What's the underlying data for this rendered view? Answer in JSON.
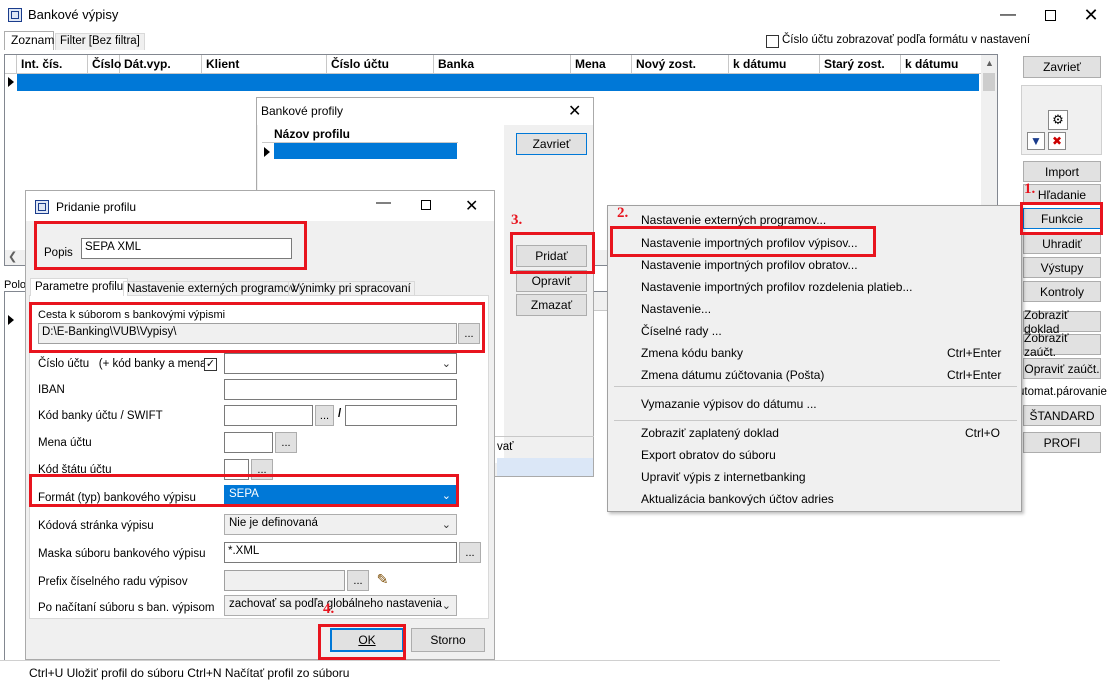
{
  "main_window": {
    "title": "Bankové výpisy",
    "tabs": [
      "Zoznam",
      "Filter [Bez filtra]"
    ],
    "checkbox_label": "Číslo účtu zobrazovať podľa formátu v nastavení",
    "columns": [
      "Int. čís.",
      "Číslo",
      "Dát.vyp.",
      "Klient",
      "Číslo účtu",
      "Banka",
      "Mena",
      "Nový zost.",
      "k dátumu",
      "Starý zost.",
      "k dátumu"
    ],
    "lower_tab_label": "Polo",
    "status_bar": "Ctrl+U Uložiť profil do súboru  Ctrl+N Načítať profil zo súboru"
  },
  "right_panel": {
    "buttons": {
      "zavriet": "Zavrieť",
      "import": "Import",
      "hladanie": "Hľadanie",
      "funkcie": "Funkcie",
      "uhradit": "Uhradiť",
      "vystupy": "Výstupy",
      "kontroly": "Kontroly",
      "zobrazit_doklad": "Zobraziť doklad",
      "zobrazit_zauct": "Zobraziť zaúčt.",
      "opravit_zauct": "Opraviť zaúčt.",
      "standard": "ŠTANDARD",
      "profi": "PROFI"
    },
    "automat_label": "utomat.párovanie"
  },
  "profiles_window": {
    "title": "Bankové profily",
    "column": "Názov profilu",
    "buttons": {
      "zavriet": "Zavrieť",
      "pridat": "Pridať",
      "opravit": "Opraviť",
      "zmazat": "Zmazať"
    },
    "partial_label": "vať"
  },
  "add_profile_dialog": {
    "title": "Pridanie profilu",
    "popis_label": "Popis",
    "popis_value": "SEPA XML",
    "tabs": [
      "Parametre profilu",
      "Nastavenie externých programov",
      "Výnimky pri spracovaní"
    ],
    "path_label": "Cesta k súborom s bankovými výpismi",
    "path_value": "D:\\E-Banking\\VUB\\Vypisy\\",
    "cislo_uctu_label": "Číslo účtu",
    "cislo_uctu_hint": "(+ kód banky a mena)",
    "iban_label": "IBAN",
    "swift_label": "Kód banky účtu / SWIFT",
    "mena_label": "Mena účtu",
    "stat_label": "Kód štátu účtu",
    "format_label": "Formát (typ) bankového výpisu",
    "format_value": "SEPA",
    "kodova_label": "Kódová stránka výpisu",
    "kodova_value": "Nie je definovaná",
    "maska_label": "Maska súboru bankového výpisu",
    "maska_value": "*.XML",
    "prefix_label": "Prefix číselného radu výpisov",
    "po_nacitani_label": "Po načítaní súboru s ban. výpisom",
    "po_nacitani_value": "zachovať sa podľa globálneho nastavenia",
    "ok": "OK",
    "storno": "Storno",
    "ellipsis": "...",
    "slash": "/"
  },
  "context_menu": {
    "items": [
      {
        "label": "Nastavenie externých programov...",
        "shortcut": ""
      },
      {
        "label": "Nastavenie importných profilov výpisov...",
        "shortcut": ""
      },
      {
        "label": "Nastavenie importných profilov obratov...",
        "shortcut": ""
      },
      {
        "label": "Nastavenie importných profilov rozdelenia platieb...",
        "shortcut": ""
      },
      {
        "label": "Nastavenie...",
        "shortcut": ""
      },
      {
        "label": "Číselné rady ...",
        "shortcut": ""
      },
      {
        "label": "Zmena kódu banky",
        "shortcut": "Ctrl+Enter"
      },
      {
        "label": "Zmena dátumu zúčtovania (Pošta)",
        "shortcut": "Ctrl+Enter"
      },
      {
        "label": "Vymazanie výpisov do dátumu ...",
        "shortcut": ""
      },
      {
        "label": "Zobraziť zaplatený doklad",
        "shortcut": "Ctrl+O"
      },
      {
        "label": "Export obratov do súboru",
        "shortcut": ""
      },
      {
        "label": "Upraviť výpis z internetbanking",
        "shortcut": ""
      },
      {
        "label": "Aktualizácia bankových účtov adries",
        "shortcut": ""
      }
    ]
  },
  "annotations": {
    "step1": "1.",
    "step2": "2.",
    "step3": "3.",
    "step4": "4.",
    "color": "#e8141e"
  },
  "colors": {
    "selection": "#0078d7",
    "accent_border": "#0078d7",
    "highlight_red": "#e8141e"
  }
}
